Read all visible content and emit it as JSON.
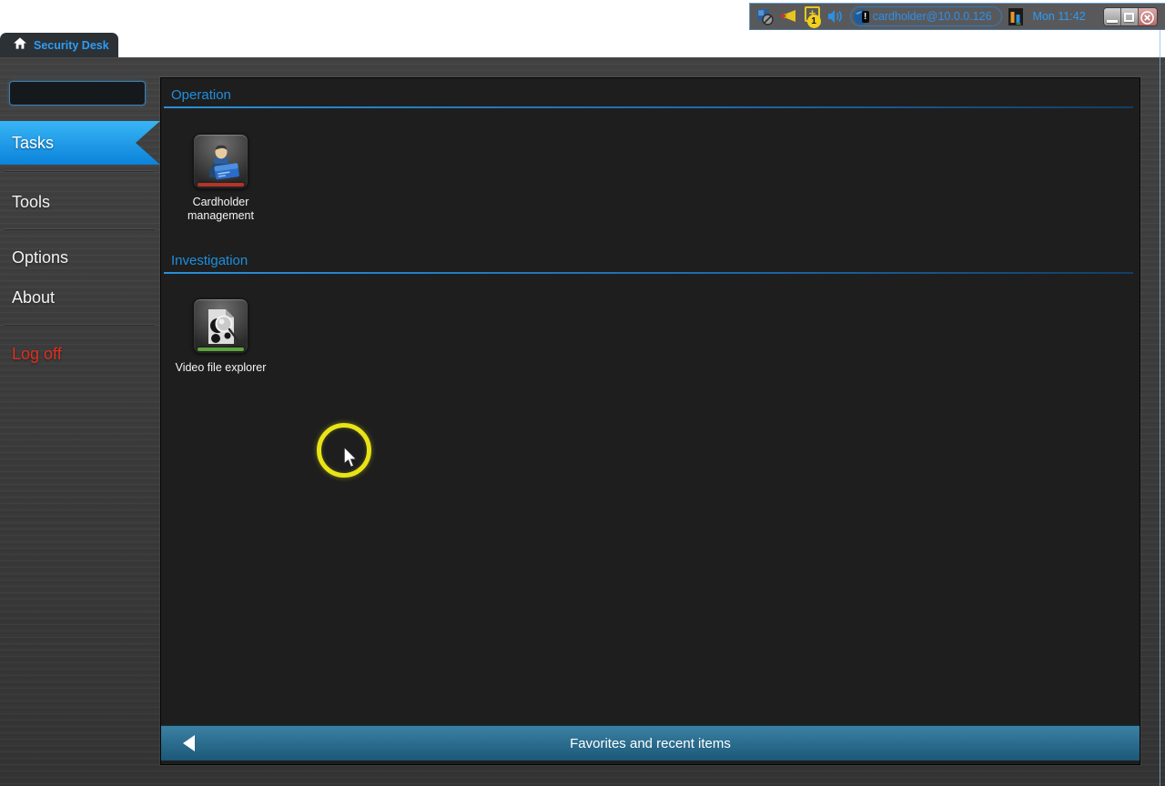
{
  "titlebar": {
    "tab_label": "Security Desk",
    "tray": {
      "alarm_badge_count": "1",
      "warning_glyph": "!",
      "user": "cardholder@10.0.0.126",
      "clock": "Mon 11:42"
    }
  },
  "sidebar": {
    "search": {
      "value": "",
      "placeholder": ""
    },
    "items": [
      {
        "label": "Tasks",
        "selected": true
      },
      {
        "label": "Tools",
        "selected": false
      },
      {
        "label": "Options",
        "selected": false
      },
      {
        "label": "About",
        "selected": false
      },
      {
        "label": "Log off",
        "selected": false
      }
    ]
  },
  "main": {
    "sections": [
      {
        "title": "Operation",
        "tiles": [
          {
            "label": "Cardholder management",
            "icon": "cardholder-icon",
            "accent_color": "#b23528"
          }
        ]
      },
      {
        "title": "Investigation",
        "tiles": [
          {
            "label": "Video file explorer",
            "icon": "video-file-explorer-icon",
            "accent_color": "#5ca33c"
          }
        ]
      }
    ],
    "bottom_bar": {
      "label": "Favorites and recent items"
    }
  },
  "icons": {
    "tab": "home-icon",
    "tray": [
      "screen-status-icon",
      "alert-horn-icon",
      "new-events-badge-icon",
      "volume-icon",
      "network-globe-icon",
      "health-stats-icon"
    ],
    "window_controls": [
      "minimize-icon",
      "maximize-icon",
      "close-icon"
    ]
  },
  "colors": {
    "accent_blue": "#1f8fdd",
    "selected_gradient_top": "#38b5f5",
    "selected_gradient_bottom": "#0b83da",
    "logoff_red": "#e03020",
    "cardholder_accent": "#b23528",
    "video_accent": "#5ca33c",
    "favbar_top": "#3b81a4",
    "favbar_bottom": "#1c5878",
    "click_ring_yellow": "#e8e417"
  }
}
